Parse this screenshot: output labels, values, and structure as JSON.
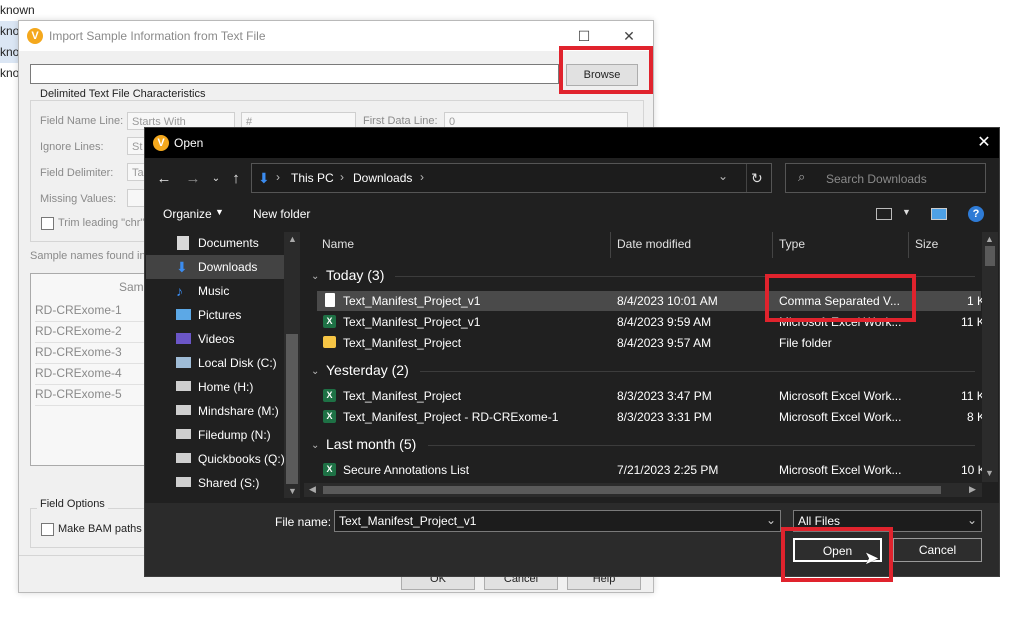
{
  "background_list": {
    "items": [
      "known",
      "known",
      "known",
      "known"
    ]
  },
  "import_dialog": {
    "title": "Import Sample Information from Text File",
    "browse_label": "Browse",
    "delimited_group": "Delimited Text File Characteristics",
    "field_name_line_label": "Field Name Line:",
    "field_name_line_mode": "Starts With",
    "field_name_line_value": "#",
    "first_data_line_label": "First Data Line:",
    "first_data_line_value": "0",
    "ignore_lines_label": "Ignore Lines:",
    "ignore_lines_mode": "St",
    "field_delimiter_label": "Field Delimiter:",
    "field_delimiter_mode": "Ta",
    "missing_values_label": "Missing Values:",
    "trim_label": "Trim leading \"chr\"",
    "sample_names_label": "Sample names found in",
    "sample_header": "Samp",
    "samples": [
      "RD-CRExome-1",
      "RD-CRExome-2",
      "RD-CRExome-3",
      "RD-CRExome-4",
      "RD-CRExome-5"
    ],
    "field_options_group": "Field Options",
    "make_bam_label": "Make BAM paths r",
    "ok_label": "OK",
    "cancel_label": "Cancel",
    "help_label": "Help"
  },
  "open_dialog": {
    "title": "Open",
    "breadcrumb": [
      "This PC",
      "Downloads"
    ],
    "search_placeholder": "Search Downloads",
    "organize_label": "Organize",
    "new_folder_label": "New folder",
    "sidebar": [
      "Documents",
      "Downloads",
      "Music",
      "Pictures",
      "Videos",
      "Local Disk (C:)",
      "Home (H:)",
      "Mindshare (M:)",
      "Filedump (N:)",
      "Quickbooks (Q:)",
      "Shared (S:)"
    ],
    "columns": {
      "name": "Name",
      "date": "Date modified",
      "type": "Type",
      "size": "Size"
    },
    "groups": [
      {
        "label": "Today (3)",
        "files": [
          {
            "name": "Text_Manifest_Project_v1",
            "date": "8/4/2023 10:01 AM",
            "type": "Comma Separated V...",
            "size": "1 K",
            "icon": "csv"
          },
          {
            "name": "Text_Manifest_Project_v1",
            "date": "8/4/2023 9:59 AM",
            "type": "Microsoft Excel Work...",
            "size": "11 K",
            "icon": "excel"
          },
          {
            "name": "Text_Manifest_Project",
            "date": "8/4/2023 9:57 AM",
            "type": "File folder",
            "size": "",
            "icon": "folder"
          }
        ]
      },
      {
        "label": "Yesterday (2)",
        "files": [
          {
            "name": "Text_Manifest_Project",
            "date": "8/3/2023 3:47 PM",
            "type": "Microsoft Excel Work...",
            "size": "11 K",
            "icon": "excel"
          },
          {
            "name": "Text_Manifest_Project - RD-CRExome-1",
            "date": "8/3/2023 3:31 PM",
            "type": "Microsoft Excel Work...",
            "size": "8 K",
            "icon": "excel"
          }
        ]
      },
      {
        "label": "Last month (5)",
        "files": [
          {
            "name": "Secure Annotations List",
            "date": "7/21/2023 2:25 PM",
            "type": "Microsoft Excel Work...",
            "size": "10 K",
            "icon": "excel"
          }
        ]
      }
    ],
    "file_name_label": "File name:",
    "file_name_value": "Text_Manifest_Project_v1",
    "filter_value": "All Files",
    "open_label": "Open",
    "cancel_label": "Cancel"
  },
  "colors": {
    "highlight": "#e0232d",
    "dark_bg": "#202020",
    "excel_green": "#1e7145"
  }
}
